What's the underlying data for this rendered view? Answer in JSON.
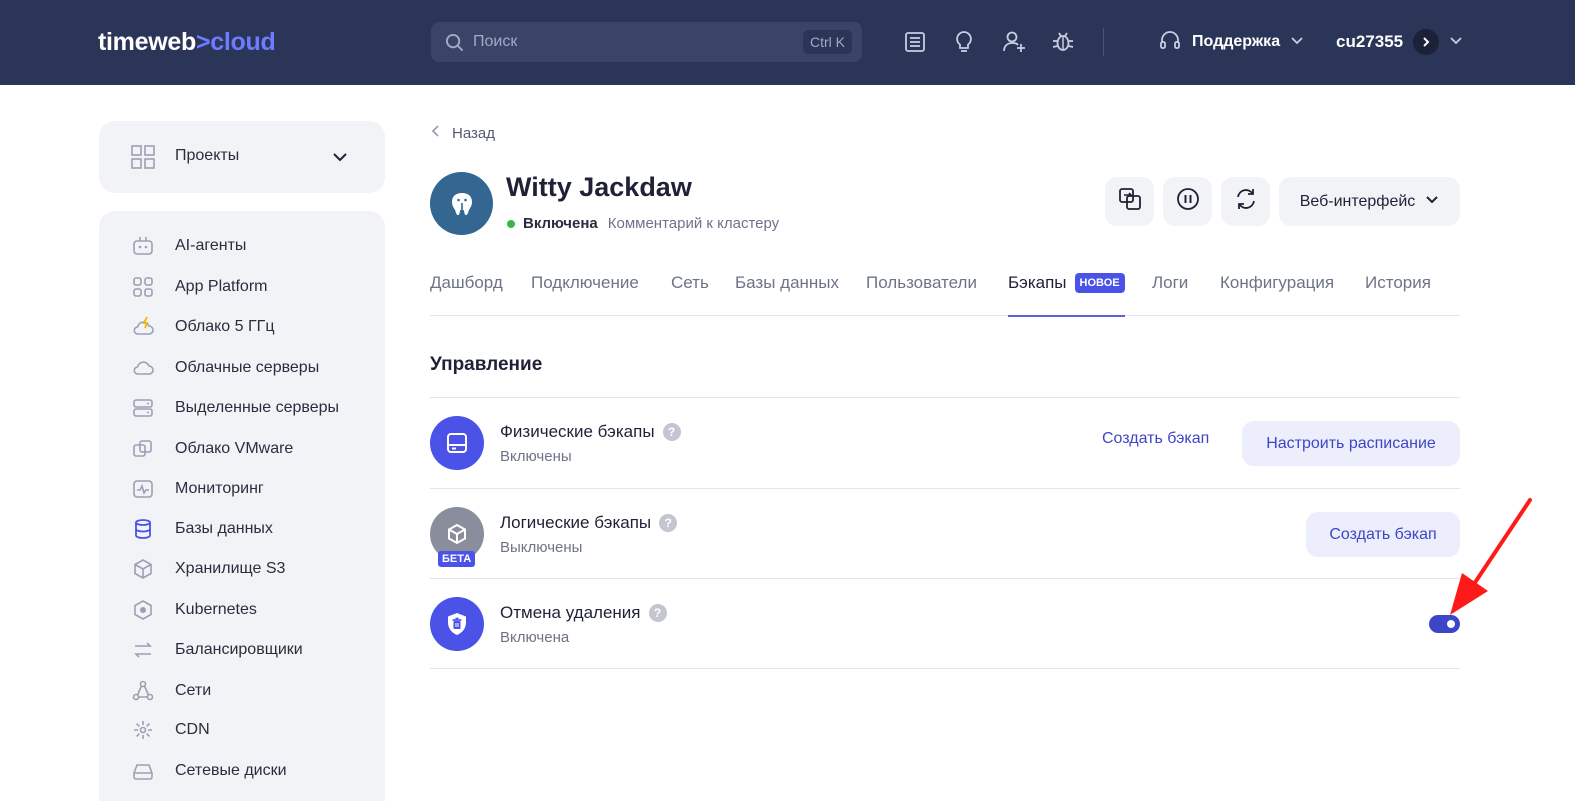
{
  "header": {
    "logo_main": "timeweb",
    "logo_sep": ">",
    "logo_accent": "cloud",
    "search_placeholder": "Поиск",
    "search_shortcut": "Ctrl K",
    "support_label": "Поддержка",
    "account_name": "cu27355",
    "icons": [
      "news-icon",
      "lightbulb-icon",
      "add-user-icon",
      "bug-icon"
    ]
  },
  "sidebar": {
    "projects_label": "Проекты",
    "items": [
      {
        "label": "AI-агенты",
        "icon": "robot-icon"
      },
      {
        "label": "App Platform",
        "icon": "grid-icon"
      },
      {
        "label": "Облако 5 ГГц",
        "icon": "cloud-bolt-icon"
      },
      {
        "label": "Облачные серверы",
        "icon": "cloud-icon"
      },
      {
        "label": "Выделенные серверы",
        "icon": "server-icon"
      },
      {
        "label": "Облако VMware",
        "icon": "vmware-icon"
      },
      {
        "label": "Мониторинг",
        "icon": "monitor-icon"
      },
      {
        "label": "Базы данных",
        "icon": "database-icon"
      },
      {
        "label": "Хранилище S3",
        "icon": "cube-icon"
      },
      {
        "label": "Kubernetes",
        "icon": "kubernetes-icon"
      },
      {
        "label": "Балансировщики",
        "icon": "arrows-icon"
      },
      {
        "label": "Сети",
        "icon": "network-icon"
      },
      {
        "label": "CDN",
        "icon": "cdn-icon"
      },
      {
        "label": "Сетевые диски",
        "icon": "disk-icon"
      }
    ]
  },
  "main": {
    "back_label": "Назад",
    "title": "Witty Jackdaw",
    "status": "Включена",
    "comment_link": "Комментарий к кластеру",
    "web_interface_label": "Веб-интерфейс",
    "tabs": [
      {
        "label": "Дашборд"
      },
      {
        "label": "Подключение"
      },
      {
        "label": "Сеть"
      },
      {
        "label": "Базы данных"
      },
      {
        "label": "Пользователи"
      },
      {
        "label": "Бэкапы",
        "badge": "НОВОЕ",
        "active": true
      },
      {
        "label": "Логи"
      },
      {
        "label": "Конфигурация"
      },
      {
        "label": "История"
      }
    ],
    "section_title": "Управление",
    "rows": [
      {
        "title": "Физические бэкапы",
        "subtitle": "Включены",
        "action_link": "Создать бэкап",
        "action_button": "Настроить расписание"
      },
      {
        "title": "Логические бэкапы",
        "subtitle": "Выключены",
        "badge": "БЕТА",
        "action_button": "Создать бэкап"
      },
      {
        "title": "Отмена удаления",
        "subtitle": "Включена",
        "toggle_on": true
      }
    ],
    "colors": {
      "accent": "#3d46c9",
      "header_bg": "#2b3558",
      "toggle_on": "#3d46c9",
      "status_ok": "#3ab54a",
      "arrow": "#ff1a1a"
    }
  }
}
